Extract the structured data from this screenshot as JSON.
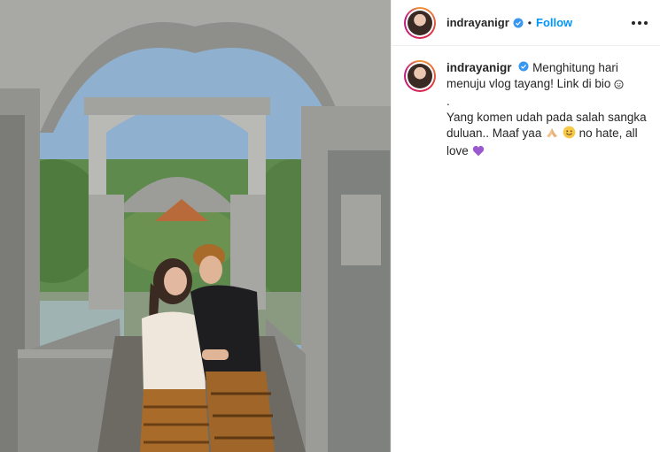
{
  "post": {
    "username": "indrayanigr",
    "follow_label": "Follow",
    "separator": "•",
    "caption_lines": [
      "Menghitung hari menuju vlog tayang! Link di bio",
      ".",
      "Yang komen udah pada salah sangka duluan.. Maaf yaa",
      "no hate, all love"
    ]
  },
  "icons": {
    "verified": "verified-badge-icon",
    "more": "more-options-icon",
    "emoji_smile_small": "smiling-face-icon",
    "emoji_pray": "folded-hands-icon",
    "emoji_smile": "smiling-face-icon",
    "emoji_heart": "purple-heart-icon"
  },
  "colors": {
    "link": "#0095f6",
    "verified": "#3897f0",
    "text": "#262626",
    "heart": "#9b59d0"
  }
}
